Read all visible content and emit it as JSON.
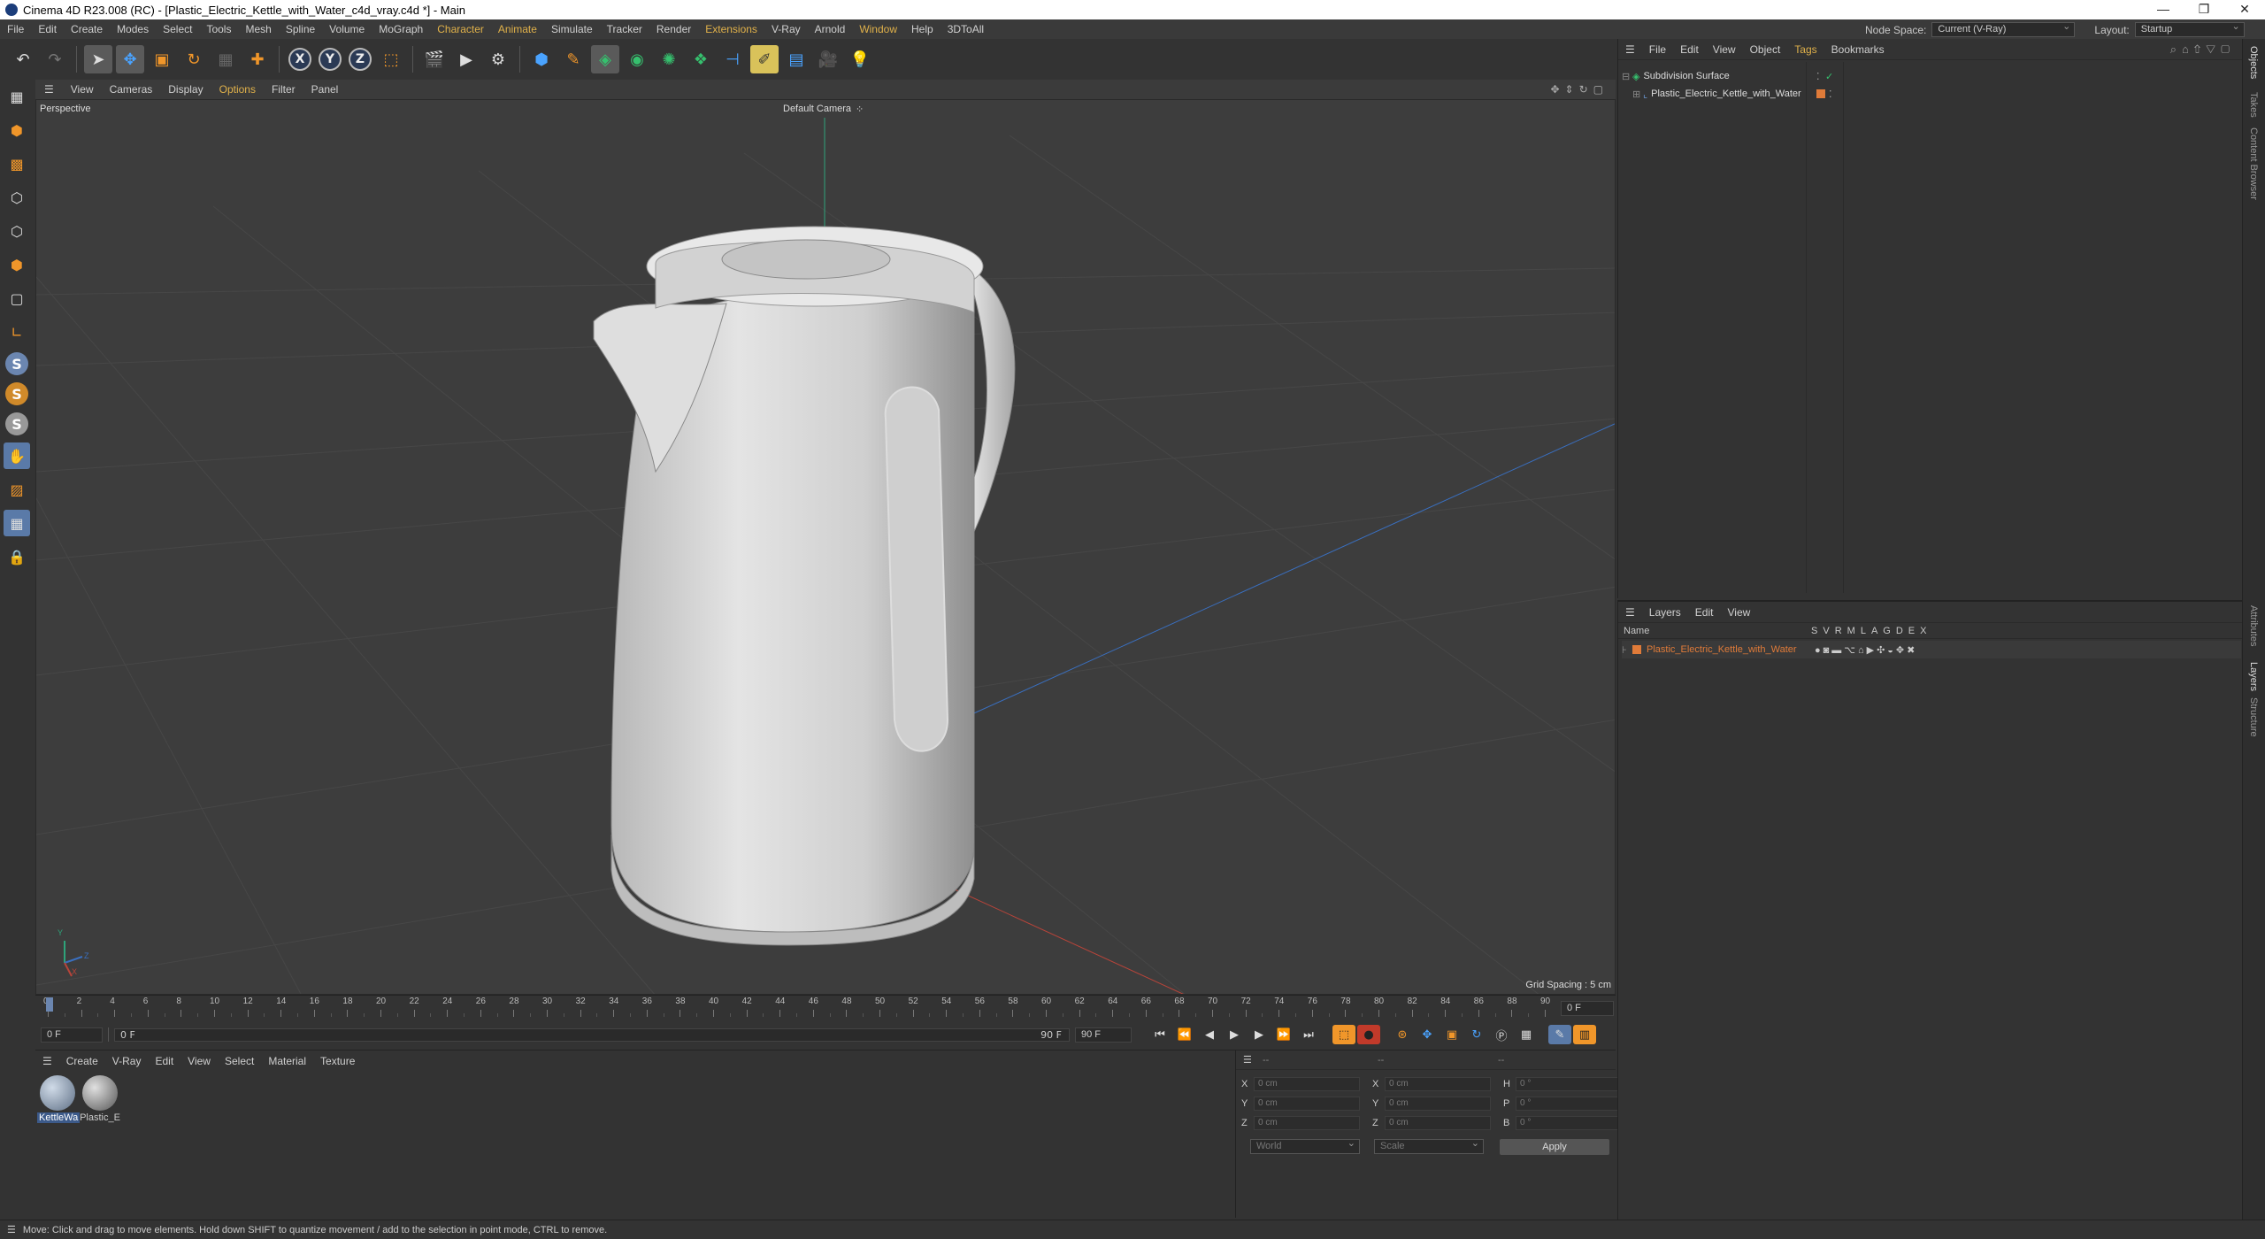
{
  "window": {
    "title": "Cinema 4D R23.008 (RC) - [Plastic_Electric_Kettle_with_Water_c4d_vray.c4d *] - Main",
    "controls": [
      "—",
      "❐",
      "✕"
    ]
  },
  "menubar": {
    "items": [
      "File",
      "Edit",
      "Create",
      "Modes",
      "Select",
      "Tools",
      "Mesh",
      "Spline",
      "Volume",
      "MoGraph",
      "Character",
      "Animate",
      "Simulate",
      "Tracker",
      "Render",
      "Extensions",
      "V-Ray",
      "Arnold",
      "Window",
      "Help",
      "3DToAll"
    ],
    "highlighted": [
      "Character",
      "Animate",
      "Extensions"
    ],
    "node_space_label": "Node Space:",
    "node_space_value": "Current (V-Ray)",
    "layout_label": "Layout:",
    "layout_value": "Startup"
  },
  "toolbar": {
    "axis_x": "X",
    "axis_y": "Y",
    "axis_z": "Z"
  },
  "left_palette": {
    "s_labels": [
      "S",
      "S",
      "S"
    ]
  },
  "viewport": {
    "menu": [
      "View",
      "Cameras",
      "Display",
      "Options",
      "Filter",
      "Panel"
    ],
    "projection": "Perspective",
    "camera": "Default Camera",
    "camera_suffix": "⁘",
    "grid_spacing": "Grid Spacing : 5 cm",
    "axis_labels": [
      "Y",
      "Z",
      "X"
    ]
  },
  "timeline": {
    "ticks": [
      "0",
      "2",
      "4",
      "6",
      "8",
      "10",
      "12",
      "14",
      "16",
      "18",
      "20",
      "22",
      "24",
      "26",
      "28",
      "30",
      "32",
      "34",
      "36",
      "38",
      "40",
      "42",
      "44",
      "46",
      "48",
      "50",
      "52",
      "54",
      "56",
      "58",
      "60",
      "62",
      "64",
      "66",
      "68",
      "70",
      "72",
      "74",
      "76",
      "78",
      "80",
      "82",
      "84",
      "86",
      "88",
      "90"
    ],
    "current_frame": "0 F",
    "start_field": "0 F",
    "start_field2": "0 F",
    "end_field": "90 F",
    "end_field2": "90 F"
  },
  "material_manager": {
    "menu": [
      "Create",
      "V-Ray",
      "Edit",
      "View",
      "Select",
      "Material",
      "Texture"
    ],
    "materials": [
      {
        "name": "KettleWa",
        "color": "#8a9bb0"
      },
      {
        "name": "Plastic_E",
        "color": "#9a9a9a"
      }
    ]
  },
  "coordinates": {
    "header": [
      "--",
      "--",
      "--"
    ],
    "rows": [
      {
        "a": "X",
        "v1": "0 cm",
        "b": "X",
        "v2": "0 cm",
        "c": "H",
        "v3": "0 °"
      },
      {
        "a": "Y",
        "v1": "0 cm",
        "b": "Y",
        "v2": "0 cm",
        "c": "P",
        "v3": "0 °"
      },
      {
        "a": "Z",
        "v1": "0 cm",
        "b": "Z",
        "v2": "0 cm",
        "c": "B",
        "v3": "0 °"
      }
    ],
    "mode": "World",
    "scale": "Scale",
    "apply": "Apply"
  },
  "object_manager": {
    "menu": [
      "File",
      "Edit",
      "View",
      "Object",
      "Tags",
      "Bookmarks"
    ],
    "highlighted": [
      "Tags"
    ],
    "objects": [
      {
        "name": "Subdivision Surface",
        "indent": 0
      },
      {
        "name": "Plastic_Electric_Kettle_with_Water",
        "indent": 1
      }
    ]
  },
  "layer_manager": {
    "menu": [
      "Layers",
      "Edit",
      "View"
    ],
    "col_name": "Name",
    "col_flags": [
      "S",
      "V",
      "R",
      "M",
      "L",
      "A",
      "G",
      "D",
      "E",
      "X"
    ],
    "layers": [
      {
        "name": "Plastic_Electric_Kettle_with_Water",
        "color": "#e07b39"
      }
    ]
  },
  "side_tabs": [
    "Objects",
    "Takes",
    "Content Browser",
    "Attributes",
    "Layers",
    "Structure"
  ],
  "status": {
    "text": "Move: Click and drag to move elements. Hold down SHIFT to quantize movement / add to the selection in point mode, CTRL to remove."
  },
  "colors": {
    "accent": "#e0b14a",
    "viewport_bg": "#3d3d3d",
    "layer_orange": "#e07b39",
    "y_axis": "#2ea37a",
    "x_axis": "#b8443a",
    "z_axis": "#3a6fbf"
  }
}
